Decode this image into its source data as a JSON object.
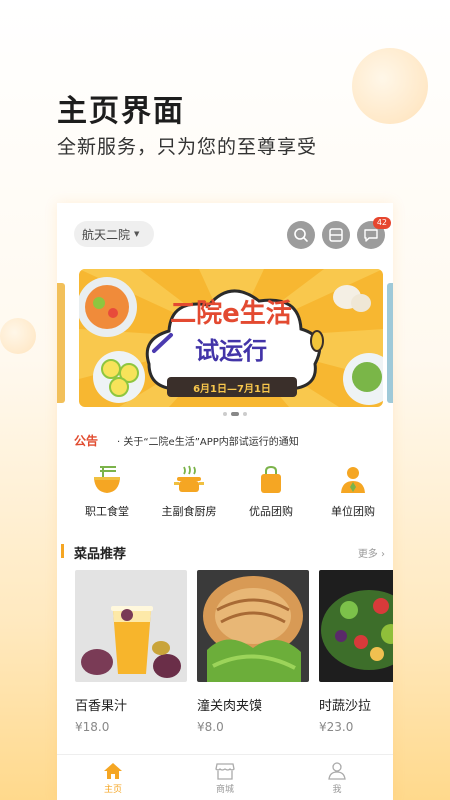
{
  "promo": {
    "title": "主页界面",
    "subtitle": "全新服务，只为您的至尊享受"
  },
  "header": {
    "location": "航天二院",
    "message_count": "42",
    "icons": [
      "search-icon",
      "scan-icon",
      "message-icon"
    ]
  },
  "banner": {
    "line1": "二院e生活",
    "line2": "试运行",
    "dates": "6月1日—7月1日"
  },
  "notice": {
    "label": "公告",
    "text": "· 关于“二院e生活”APP内部试运行的通知"
  },
  "categories": [
    {
      "label": "职工食堂",
      "icon": "bowl-icon"
    },
    {
      "label": "主副食厨房",
      "icon": "pot-icon"
    },
    {
      "label": "优品团购",
      "icon": "bag-icon"
    },
    {
      "label": "单位团购",
      "icon": "person-icon"
    }
  ],
  "recommend": {
    "title": "菜品推荐",
    "more": "更多",
    "items": [
      {
        "name": "百香果汁",
        "price": "¥18.0"
      },
      {
        "name": "潼关肉夹馍",
        "price": "¥8.0"
      },
      {
        "name": "时蔬沙拉",
        "price": "¥23.0"
      }
    ]
  },
  "tabbar": [
    {
      "label": "主页",
      "icon": "home-icon",
      "active": true
    },
    {
      "label": "商城",
      "icon": "shop-icon",
      "active": false
    },
    {
      "label": "我",
      "icon": "user-icon",
      "active": false
    }
  ],
  "colors": {
    "accent": "#f5a623",
    "notice": "#e14b2f",
    "badge": "#e6462e"
  }
}
